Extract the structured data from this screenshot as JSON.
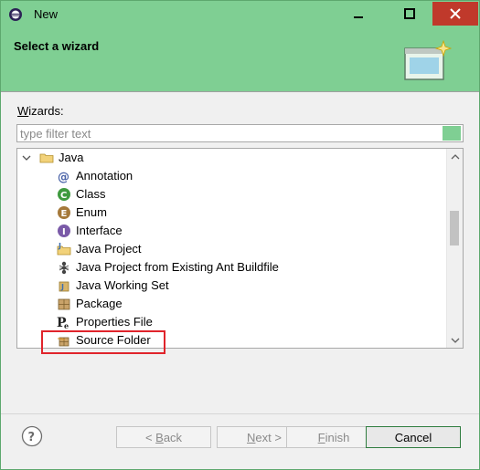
{
  "window": {
    "title": "New"
  },
  "banner": {
    "heading": "Select a wizard"
  },
  "wizards_label": {
    "underlined": "W",
    "rest": "izards:"
  },
  "filter": {
    "placeholder": "type filter text",
    "value": ""
  },
  "tree": {
    "root": {
      "label": "Java",
      "expanded": true
    },
    "items": [
      {
        "label": "Annotation",
        "icon": "annotation-icon"
      },
      {
        "label": "Class",
        "icon": "class-icon"
      },
      {
        "label": "Enum",
        "icon": "enum-icon"
      },
      {
        "label": "Interface",
        "icon": "interface-icon"
      },
      {
        "label": "Java Project",
        "icon": "java-project-icon"
      },
      {
        "label": "Java Project from Existing Ant Buildfile",
        "icon": "ant-icon"
      },
      {
        "label": "Java Working Set",
        "icon": "working-set-icon"
      },
      {
        "label": "Package",
        "icon": "package-icon"
      },
      {
        "label": "Properties File",
        "icon": "properties-file-icon"
      },
      {
        "label": "Source Folder",
        "icon": "source-folder-icon"
      }
    ],
    "highlighted": "Source Folder"
  },
  "buttons": {
    "back": {
      "prefix": "< ",
      "underlined": "B",
      "rest": "ack",
      "enabled": false
    },
    "next": {
      "underlined": "N",
      "rest": "ext >",
      "enabled": false
    },
    "finish": {
      "underlined": "F",
      "rest": "inish",
      "enabled": false
    },
    "cancel": {
      "label": "Cancel",
      "enabled": true
    }
  },
  "colors": {
    "accent": "#7fcf93",
    "highlight": "#e0242b"
  }
}
